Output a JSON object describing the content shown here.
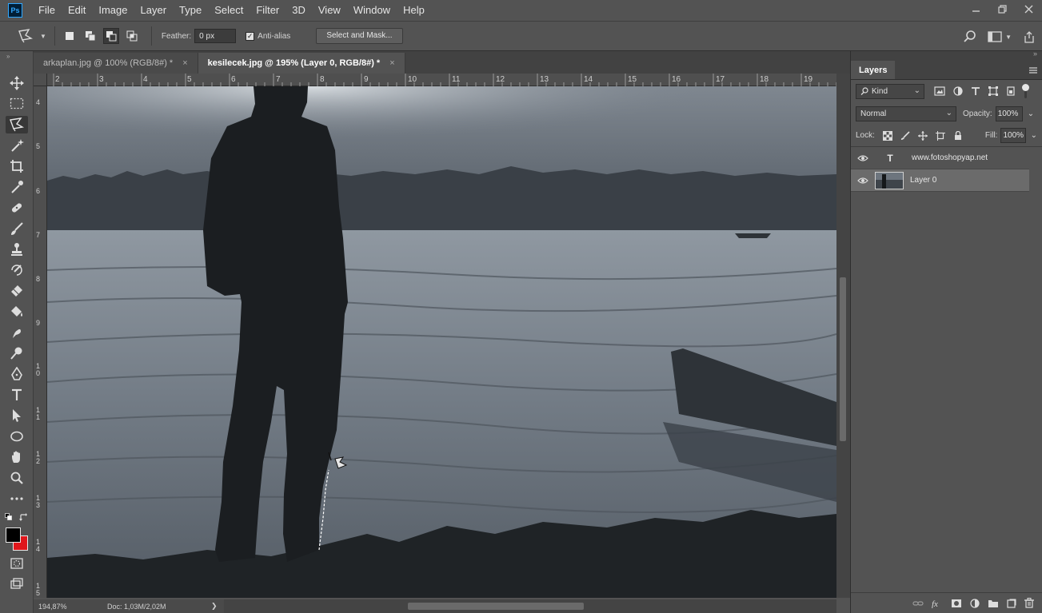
{
  "menubar": {
    "logo": "Ps",
    "items": [
      "File",
      "Edit",
      "Image",
      "Layer",
      "Type",
      "Select",
      "Filter",
      "3D",
      "View",
      "Window",
      "Help"
    ],
    "window_controls": [
      "minimize-icon",
      "restore-icon",
      "close-icon"
    ]
  },
  "options": {
    "feather_label": "Feather:",
    "feather_value": "0 px",
    "antialias_label": "Anti-alias",
    "antialias_checked": true,
    "select_mask_label": "Select and Mask..."
  },
  "tabs": [
    {
      "label": "arkaplan.jpg @ 100% (RGB/8#) *",
      "close": "×",
      "active": false
    },
    {
      "label": "kesilecek.jpg @ 195% (Layer 0, RGB/8#) *",
      "close": "×",
      "active": true
    }
  ],
  "rulers": {
    "horizontal": [
      "2",
      "3",
      "4",
      "5",
      "6",
      "7",
      "8",
      "9",
      "10",
      "11",
      "12",
      "13",
      "14",
      "15",
      "16",
      "17",
      "18",
      "19"
    ],
    "vertical": [
      "4",
      "5",
      "6",
      "7",
      "8",
      "9",
      "1\n0",
      "1\n1",
      "1\n2",
      "1\n3",
      "1\n4",
      "1\n5"
    ]
  },
  "status": {
    "zoom": "194,87%",
    "doc": "Doc: 1,03M/2,02M",
    "arrow": "❯"
  },
  "layers_panel": {
    "tab_label": "Layers",
    "filter_kind": "Kind",
    "blend_mode": "Normal",
    "opacity_label": "Opacity:",
    "opacity_value": "100%",
    "lock_label": "Lock:",
    "fill_label": "Fill:",
    "fill_value": "100%",
    "layers": [
      {
        "name": "www.fotoshopyap.net",
        "type_glyph": "T",
        "selected": false
      },
      {
        "name": "Layer 0",
        "type_glyph": "",
        "selected": true
      }
    ]
  },
  "colors": {
    "foreground": "#000000",
    "background": "#e0161b",
    "accent": "#31a8ff"
  }
}
